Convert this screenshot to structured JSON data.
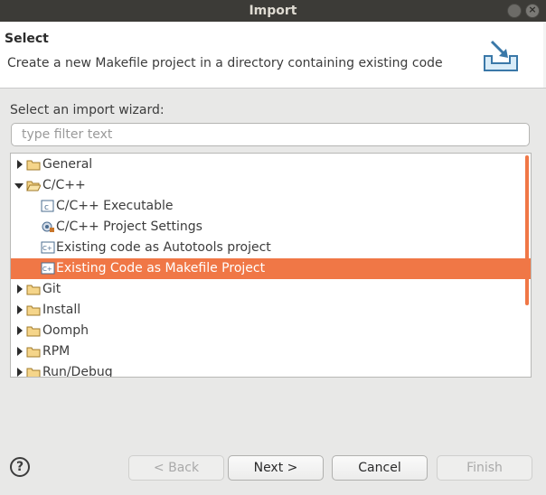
{
  "window": {
    "title": "Import",
    "close_glyph": "×"
  },
  "header": {
    "title": "Select",
    "description": "Create a new Makefile project in a directory containing existing code",
    "icon": "import-wizard-icon"
  },
  "filter": {
    "label": "Select an import wizard:",
    "placeholder": "type filter text",
    "value": ""
  },
  "tree": {
    "items": [
      {
        "label": "General",
        "icon": "folder-icon",
        "expanded": false,
        "level": 0
      },
      {
        "label": "C/C++",
        "icon": "folder-open-icon",
        "expanded": true,
        "level": 0
      },
      {
        "label": "C/C++ Executable",
        "icon": "c-file-icon",
        "level": 1
      },
      {
        "label": "C/C++ Project Settings",
        "icon": "settings-icon",
        "level": 1
      },
      {
        "label": "Existing code as Autotools project",
        "icon": "cpp-project-icon",
        "level": 1
      },
      {
        "label": "Existing Code as Makefile Project",
        "icon": "cpp-project-icon",
        "level": 1,
        "selected": true
      },
      {
        "label": "Git",
        "icon": "folder-icon",
        "expanded": false,
        "level": 0
      },
      {
        "label": "Install",
        "icon": "folder-icon",
        "expanded": false,
        "level": 0
      },
      {
        "label": "Oomph",
        "icon": "folder-icon",
        "expanded": false,
        "level": 0
      },
      {
        "label": "RPM",
        "icon": "folder-icon",
        "expanded": false,
        "level": 0
      },
      {
        "label": "Run/Debug",
        "icon": "folder-icon",
        "expanded": false,
        "level": 0
      }
    ]
  },
  "buttons": {
    "help": "?",
    "back": "< Back",
    "next": "Next >",
    "cancel": "Cancel",
    "finish": "Finish"
  },
  "colors": {
    "selection": "#f07746",
    "titlebar": "#3c3b37"
  }
}
